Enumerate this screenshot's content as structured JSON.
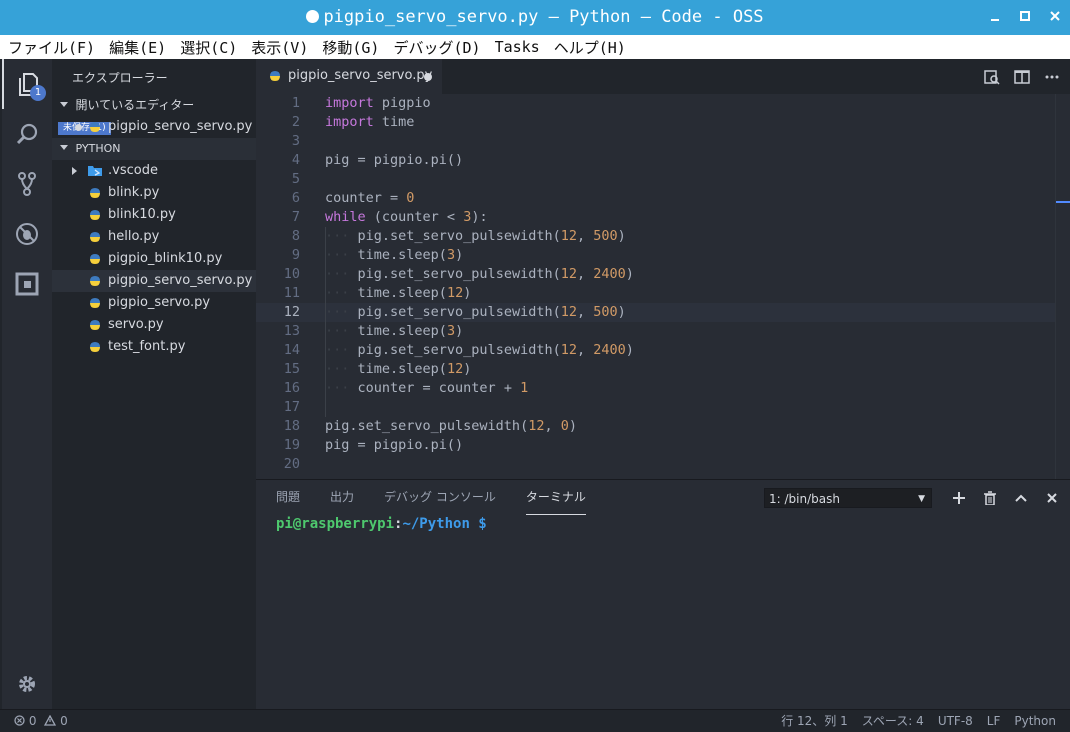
{
  "window": {
    "title": "pigpio_servo_servo.py — Python — Code - OSS",
    "buttons": [
      "minimize",
      "maximize",
      "close"
    ]
  },
  "menu": [
    "ファイル(F)",
    "編集(E)",
    "選択(C)",
    "表示(V)",
    "移動(G)",
    "デバッグ(D)",
    "Tasks",
    "ヘルプ(H)"
  ],
  "activity_bar": {
    "explorer_badge": "1",
    "icons": [
      "files-icon",
      "search-icon",
      "source-control-icon",
      "debug-icon",
      "extensions-icon",
      "settings-gear-icon"
    ]
  },
  "sidebar": {
    "title": "エクスプローラー",
    "open_editors": {
      "label": "開いているエディター",
      "badge": "未保存 (1)",
      "items": [
        {
          "name": "pigpio_servo_servo.py"
        }
      ]
    },
    "folder": {
      "label": "PYTHON",
      "items": [
        {
          "name": ".vscode"
        },
        {
          "name": "blink.py"
        },
        {
          "name": "blink10.py"
        },
        {
          "name": "hello.py"
        },
        {
          "name": "pigpio_blink10.py"
        },
        {
          "name": "pigpio_servo_servo.py"
        },
        {
          "name": "pigpio_servo.py"
        },
        {
          "name": "servo.py"
        },
        {
          "name": "test_font.py"
        }
      ]
    }
  },
  "editor": {
    "tab": {
      "label": "pigpio_servo_servo.py"
    },
    "line_numbers": [
      "1",
      "2",
      "3",
      "4",
      "5",
      "6",
      "7",
      "8",
      "9",
      "10",
      "11",
      "12",
      "13",
      "14",
      "15",
      "16",
      "17",
      "18",
      "19",
      "20"
    ],
    "lines": [
      "import pigpio",
      "import time",
      "",
      "pig = pigpio.pi()",
      "",
      "counter = 0",
      "while (counter < 3):",
      "    pig.set_servo_pulsewidth(12, 500)",
      "    time.sleep(3)",
      "    pig.set_servo_pulsewidth(12, 2400)",
      "    time.sleep(12)",
      "    pig.set_servo_pulsewidth(12, 500)",
      "    time.sleep(3)",
      "    pig.set_servo_pulsewidth(12, 2400)",
      "    time.sleep(12)",
      "    counter = counter + 1",
      "",
      "pig.set_servo_pulsewidth(12, 0)",
      "pig = pigpio.pi()",
      ""
    ],
    "current_line": 12
  },
  "panel": {
    "tabs": [
      "問題",
      "出力",
      "デバッグ コンソール",
      "ターミナル"
    ],
    "active_tab": "ターミナル",
    "terminal_select": "1: /bin/bash",
    "prompt": {
      "user": "pi@raspberrypi",
      "sep": ":",
      "path": "~/Python $"
    }
  },
  "status": {
    "errors": "0",
    "warnings": "0",
    "position": "行 12、列 1",
    "spaces": "スペース: 4",
    "encoding": "UTF-8",
    "eol": "LF",
    "language": "Python"
  },
  "colors": {
    "titlebar": "#36a2d8",
    "keyword": "#c678dd",
    "number": "#d19a66",
    "terminal_user": "#4ec96e",
    "terminal_path": "#3e9bea",
    "badge": "#4d78cc"
  }
}
